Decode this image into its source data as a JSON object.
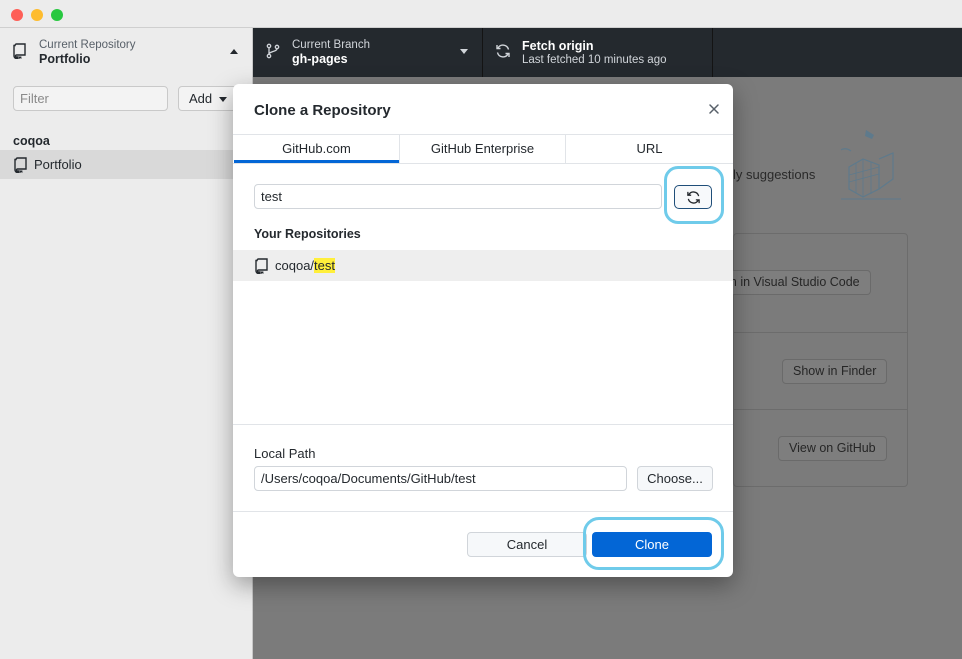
{
  "toolbar": {
    "repository": {
      "sub": "Current Repository",
      "main": "Portfolio"
    },
    "branch": {
      "sub": "Current Branch",
      "main": "gh-pages"
    },
    "fetch": {
      "main": "Fetch origin",
      "sub": "Last fetched 10 minutes ago"
    }
  },
  "sidebar": {
    "filter_placeholder": "Filter",
    "add_label": "Add",
    "group_title": "coqoa",
    "repos": [
      {
        "label": "Portfolio"
      }
    ]
  },
  "background": {
    "suggestions_text": "ly suggestions",
    "buttons": {
      "visual_studio": "pen in Visual Studio Code",
      "finder": "Show in Finder",
      "github": "View on GitHub"
    }
  },
  "dialog": {
    "title": "Clone a Repository",
    "tabs": [
      "GitHub.com",
      "GitHub Enterprise",
      "URL"
    ],
    "active_tab": "GitHub.com",
    "search_value": "test",
    "section_label": "Your Repositories",
    "repositories": [
      {
        "owner": "coqoa/",
        "name": "test"
      }
    ],
    "local_path_label": "Local Path",
    "local_path_value": "/Users/coqoa/Documents/GitHub/test",
    "choose_label": "Choose...",
    "cancel_label": "Cancel",
    "clone_label": "Clone"
  },
  "colors": {
    "accent": "#0366d6",
    "highlight_ring": "#6fcbea",
    "match_highlight": "#ffef3b",
    "toolbar_bg": "#24292e"
  }
}
